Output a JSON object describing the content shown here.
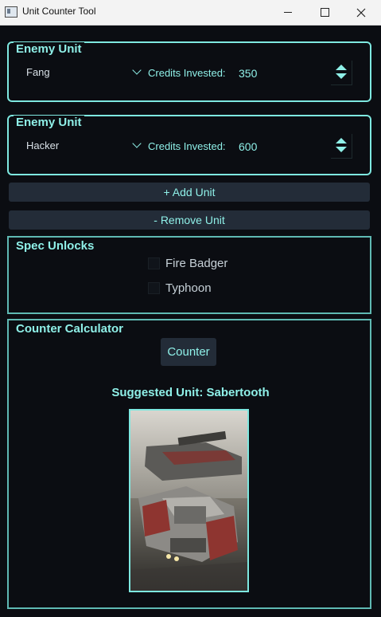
{
  "window": {
    "title": "Unit Counter Tool",
    "minimize": "minimize",
    "maximize": "maximize",
    "close": "close"
  },
  "enemy_units": [
    {
      "group_title": "Enemy Unit",
      "unit": "Fang",
      "credits_label": "Credits Invested:",
      "credits": "350"
    },
    {
      "group_title": "Enemy Unit",
      "unit": "Hacker",
      "credits_label": "Credits Invested:",
      "credits": "600"
    }
  ],
  "buttons": {
    "add_unit": "+ Add Unit",
    "remove_unit": "- Remove Unit",
    "counter": "Counter"
  },
  "spec_unlocks": {
    "title": "Spec Unlocks",
    "options": [
      {
        "label": "Fire Badger",
        "checked": false
      },
      {
        "label": "Typhoon",
        "checked": false
      }
    ]
  },
  "counter_calculator": {
    "title": "Counter Calculator",
    "suggested": "Suggested Unit: Sabertooth"
  },
  "colors": {
    "accent": "#8ff0e8",
    "background": "#0b0d12",
    "button_bg": "#232c38"
  },
  "icons": {
    "app": "window-app-icon",
    "combo": "chevron-down-icon",
    "spinner_up": "triangle-up-icon",
    "spinner_down": "triangle-down-icon"
  }
}
